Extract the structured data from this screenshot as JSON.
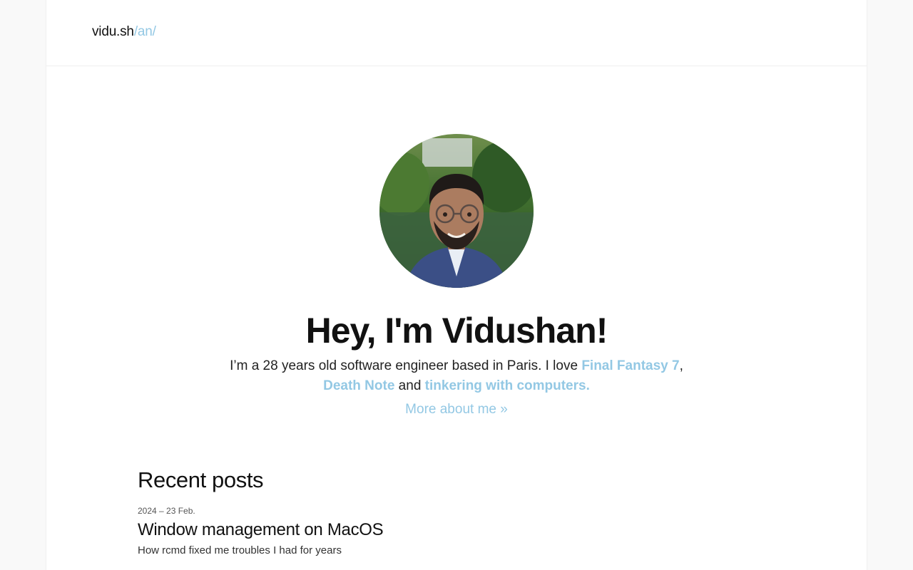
{
  "header": {
    "logo_main": "vidu.sh",
    "logo_suffix": "/an/"
  },
  "hero": {
    "title": "Hey, I'm Vidushan!",
    "intro_prefix": "I’m a 28 years old software engineer based in Paris. I love ",
    "link_ff7": "Final Fantasy 7",
    "sep_comma": ", ",
    "link_deathnote": "Death Note",
    "word_and": " and ",
    "link_tinkering": "tinkering with computers.",
    "more_link": "More about me »"
  },
  "recent": {
    "heading": "Recent posts",
    "posts": [
      {
        "date": "2024 – 23 Feb.",
        "title": "Window management on MacOS",
        "description": "How rcmd fixed me troubles I had for years"
      }
    ]
  },
  "colors": {
    "accent": "#93c8e4",
    "text": "#111111",
    "page_bg": "#ffffff",
    "outer_bg": "#f9f9f9"
  },
  "icons": {
    "avatar": "profile-photo"
  }
}
